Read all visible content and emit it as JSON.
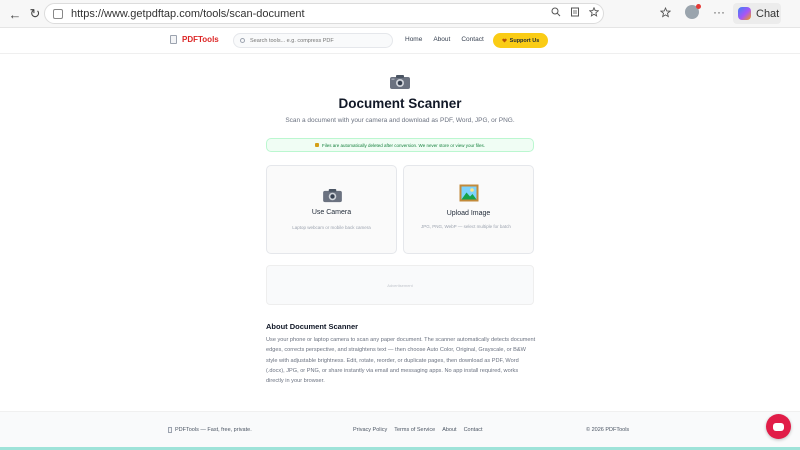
{
  "browser": {
    "url": "https://www.getpdftap.com/tools/scan-document",
    "chat_label": "Chat",
    "back_glyph": "←",
    "refresh_glyph": "↻",
    "more_glyph": "···"
  },
  "header": {
    "brand": "PDFTools",
    "search_placeholder": "Search tools... e.g. compress PDF",
    "nav": {
      "home": "Home",
      "about": "About",
      "contact": "Contact"
    },
    "support_label": "Support Us"
  },
  "main": {
    "title": "Document Scanner",
    "subtitle": "Scan a document with your camera and download as PDF, Word, JPG, or PNG.",
    "notice": "Files are automatically deleted after conversion. We never store or view your files.",
    "cards": {
      "camera": {
        "title": "Use Camera",
        "desc": "Laptop webcam or mobile back camera"
      },
      "upload": {
        "title": "Upload Image",
        "desc": "JPG, PNG, WebP — select multiple for batch"
      }
    },
    "ad_label": "Advertisement",
    "about": {
      "title": "About Document Scanner",
      "text": "Use your phone or laptop camera to scan any paper document. The scanner automatically detects document edges, corrects perspective, and straightens text — then choose Auto Color, Original, Grayscale, or B&W style with adjustable brightness. Edit, rotate, reorder, or duplicate pages, then download as PDF, Word (.docx), JPG, or PNG, or share instantly via email and messaging apps. No app install required, works directly in your browser."
    }
  },
  "footer": {
    "brand": "PDFTools — Fast, free, private.",
    "links": {
      "privacy": "Privacy Policy",
      "terms": "Terms of Service",
      "about": "About",
      "contact": "Contact"
    },
    "copyright": "© 2026 PDFTools"
  },
  "colors": {
    "brand_red": "#dc2626",
    "support_yellow": "#facc15",
    "notice_green": "#15803d",
    "chat_bubble": "#e11d48"
  }
}
